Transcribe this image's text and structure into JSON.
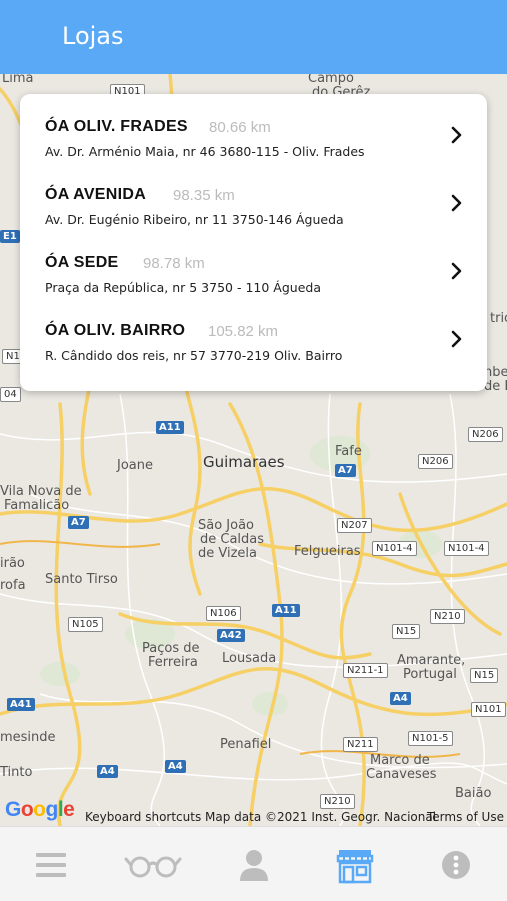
{
  "header": {
    "title": "Lojas"
  },
  "stores": [
    {
      "name": "ÓA OLIV. FRADES",
      "distance": "80.66 km",
      "address": "Av. Dr. Arménio Maia, nr 46 3680-115 - Oliv. Frades"
    },
    {
      "name": "ÓA AVENIDA",
      "distance": "98.35 km",
      "address": "Av. Dr. Eugénio Ribeiro, nr 11 3750-146 Águeda"
    },
    {
      "name": "ÓA SEDE",
      "distance": "98.78 km",
      "address": "Praça da República, nr 5 3750 - 110 Águeda"
    },
    {
      "name": "ÓA OLIV. BAIRRO",
      "distance": "105.82 km",
      "address": "R. Cândido dos reis, nr 57 3770-219 Oliv. Bairro"
    }
  ],
  "map": {
    "towns": {
      "lima": "Lima",
      "campo": "Campo",
      "dogerez": "do Gerêz",
      "joane": "Joane",
      "guimaraes": "Guimaraes",
      "fafe": "Fafe",
      "vilanova": "Vila Nova de",
      "famalicao": "Famalicão",
      "saojoao1": "São João",
      "saojoao2": "de Caldas",
      "saojoao3": "de Vizela",
      "felgueiras": "Felgueiras",
      "irao": "irão",
      "trofa": "rofa",
      "santotirso": "Santo Tirso",
      "pacos1": "Paços de",
      "pacos2": "Ferreira",
      "lousada": "Lousada",
      "amarante": "Amarante,",
      "portugal": "Portugal",
      "mesinde": "mesinde",
      "penafiel": "Penafiel",
      "tinto": "Tinto",
      "marco1": "Marco de",
      "marco2": "Canaveses",
      "baiao": "Baião",
      "tric": "tric",
      "nbec": "nbec",
      "dreb": "de B"
    },
    "roads": {
      "n101a": "N101",
      "a11a": "A11",
      "a7a": "A7",
      "n206a": "N206",
      "n206b": "N206",
      "a7b": "A7",
      "n207": "N207",
      "n1014a": "N101-4",
      "n1014b": "N101-4",
      "n105": "N105",
      "n106": "N106",
      "a11b": "A11",
      "n210a": "N210",
      "a42": "A42",
      "n15a": "N15",
      "n2111": "N211-1",
      "n15b": "N15",
      "a41": "A41",
      "a4a": "A4",
      "n101b": "N101",
      "n1015": "N101-5",
      "a4b": "A4",
      "a4c": "A4",
      "n211": "N211",
      "n210b": "N210",
      "e1": "E1",
      "n1": "N1",
      "n04": "04"
    }
  },
  "attribution": {
    "google": "Google",
    "shortcuts": "Keyboard shortcuts",
    "mapdata": "Map data ©2021 Inst. Geogr. Nacional",
    "terms": "Terms of Use"
  },
  "tabs": [
    {
      "icon": "menu-icon",
      "active": false
    },
    {
      "icon": "glasses-icon",
      "active": false
    },
    {
      "icon": "user-icon",
      "active": false
    },
    {
      "icon": "store-icon",
      "active": true
    },
    {
      "icon": "more-icon",
      "active": false
    }
  ],
  "colors": {
    "header": "#5aa9f7",
    "active_tab": "#5aa9f7",
    "inactive_tab": "#bdbdbd",
    "road_major": "#f6cf65",
    "motorway_shield": "#2e6fb6"
  }
}
